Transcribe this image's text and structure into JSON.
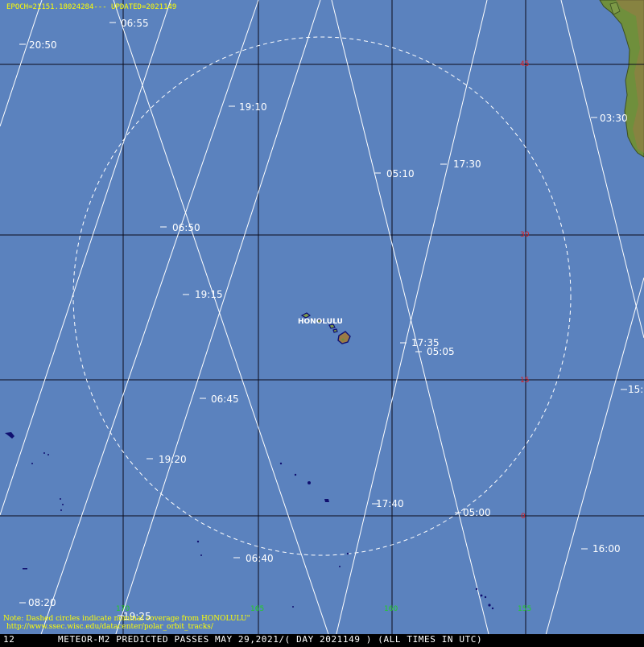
{
  "header": {
    "epoch_text": "EPOCH=21151.18024284---  UPDATED=2021149"
  },
  "city": {
    "name": "HONOLULU"
  },
  "note": {
    "line1": "Note: Dashed circles indicate nominal coverage from HONOLULU\"",
    "line2": "http://www.ssec.wisc.edu/datacenter/polar_orbit_tracks/"
  },
  "footer": {
    "left_number": "12",
    "title": "METEOR-M2 PREDICTED PASSES MAY 29,2021/( DAY 2021149 ) (ALL TIMES IN UTC)"
  },
  "grid": {
    "latitude_labels": [
      "45",
      "30",
      "15",
      "0"
    ],
    "longitude_labels": [
      "170",
      "165",
      "160",
      "155"
    ]
  },
  "track_times": [
    "06:55",
    "20:50",
    "19:10",
    "03:30",
    "17:30",
    "05:10",
    "06:50",
    "19:15",
    "17:35",
    "05:05",
    "06:45",
    "15:",
    "19:20",
    "17:40",
    "05:00",
    "06:40",
    "16:00",
    "08:20",
    "19:25"
  ],
  "colors": {
    "ocean": "#5b82be",
    "grid": "#0b0b1a",
    "track": "#ffffff",
    "latitude_label": "#e01818",
    "longitude_label": "#20d020",
    "header_text": "#ffff00",
    "land_green": "#6f8f3c",
    "land_brown": "#9a7a45",
    "island_outline": "#101070"
  },
  "coverage_circle": "dashed"
}
